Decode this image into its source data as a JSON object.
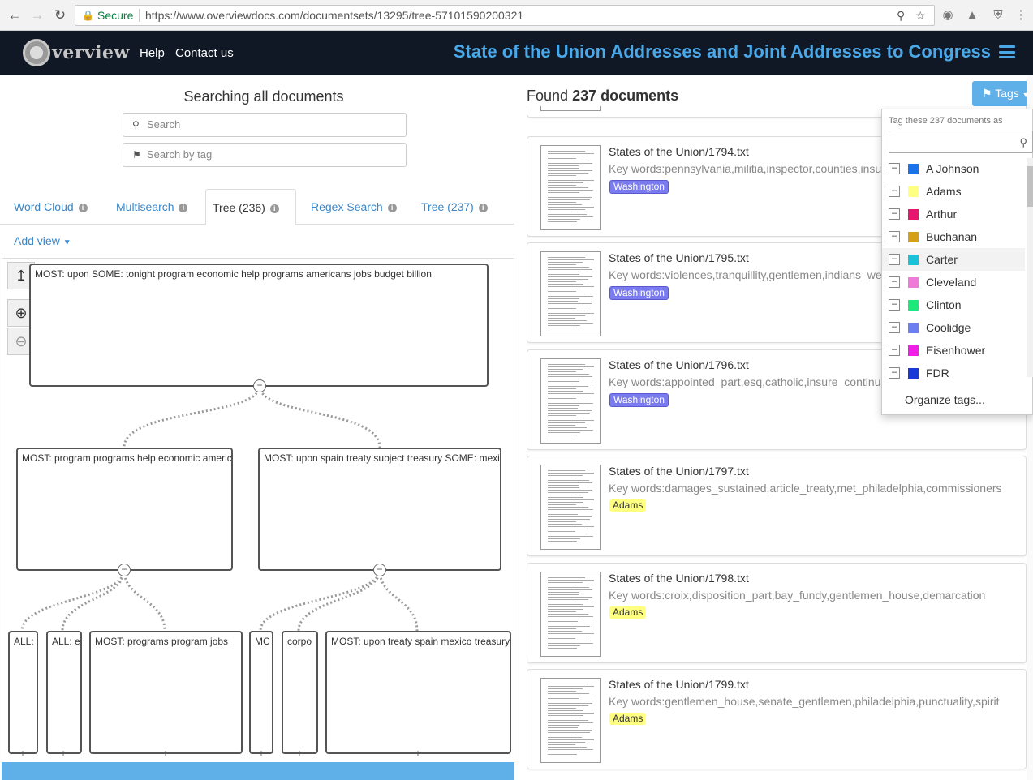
{
  "browser": {
    "secure_label": "Secure",
    "url": "https://www.overviewdocs.com/documentsets/13295/tree-57101590200321"
  },
  "header": {
    "logo_text": "verview",
    "links": [
      "Help",
      "Contact us"
    ],
    "title": "State of the Union Addresses and Joint Addresses to Congress"
  },
  "search": {
    "heading": "Searching all documents",
    "search_placeholder": "Search",
    "tag_placeholder": "Search by tag"
  },
  "tabs": [
    {
      "label": "Word Cloud"
    },
    {
      "label": "Multisearch"
    },
    {
      "label": "Tree (236)"
    },
    {
      "label": "Regex Search"
    },
    {
      "label": "Tree (237)"
    }
  ],
  "add_view": "Add view",
  "tree": {
    "root": "MOST: upon  SOME: tonight program economic help programs americans jobs budget billion",
    "level1": [
      "MOST: program programs help economic americans",
      "MOST: upon spain treaty subject treasury  SOME: mexico"
    ],
    "level2": [
      "ALL:",
      "ALL: e",
      "MOST: programs program jobs",
      "MC",
      "corpo",
      "MOST: upon treaty spain mexico treasury"
    ]
  },
  "results": {
    "found_prefix": "Found",
    "found_count": "237 documents",
    "tags_button": "Tags",
    "documents": [
      {
        "title": "States of the Union/1794.txt",
        "keywords": "Key words:pennsylvania,militia,inspector,counties,insurrection",
        "tag": "Washington",
        "tag_color": "#7b7bf0"
      },
      {
        "title": "States of the Union/1795.txt",
        "keywords": "Key words:violences,tranquillity,gentlemen,indians_west",
        "tag": "Washington",
        "tag_color": "#7b7bf0"
      },
      {
        "title": "States of the Union/1796.txt",
        "keywords": "Key words:appointed_part,esq,catholic,insure_continuance",
        "tag": "Washington",
        "tag_color": "#7b7bf0"
      },
      {
        "title": "States of the Union/1797.txt",
        "keywords": "Key words:damages_sustained,article_treaty,met_philadelphia,commissioners",
        "tag": "Adams",
        "tag_color": "#ffff80"
      },
      {
        "title": "States of the Union/1798.txt",
        "keywords": "Key words:croix,disposition_part,bay_fundy,gentlemen_house,demarcation",
        "tag": "Adams",
        "tag_color": "#ffff80"
      },
      {
        "title": "States of the Union/1799.txt",
        "keywords": "Key words:gentlemen_house,senate_gentlemen,philadelphia,punctuality,spirit",
        "tag": "Adams",
        "tag_color": "#ffff80"
      }
    ]
  },
  "tag_dropdown": {
    "caption": "Tag these 237 documents as",
    "tags": [
      {
        "name": "A Johnson",
        "color": "#1a73e8"
      },
      {
        "name": "Adams",
        "color": "#ffff80"
      },
      {
        "name": "Arthur",
        "color": "#e8156e"
      },
      {
        "name": "Buchanan",
        "color": "#d4a017"
      },
      {
        "name": "Carter",
        "color": "#18c2d8"
      },
      {
        "name": "Cleveland",
        "color": "#f07ad8"
      },
      {
        "name": "Clinton",
        "color": "#1ee87a"
      },
      {
        "name": "Coolidge",
        "color": "#6b7ff0"
      },
      {
        "name": "Eisenhower",
        "color": "#f01ee8"
      },
      {
        "name": "FDR",
        "color": "#1a3ad8"
      }
    ],
    "organize": "Organize tags..."
  }
}
